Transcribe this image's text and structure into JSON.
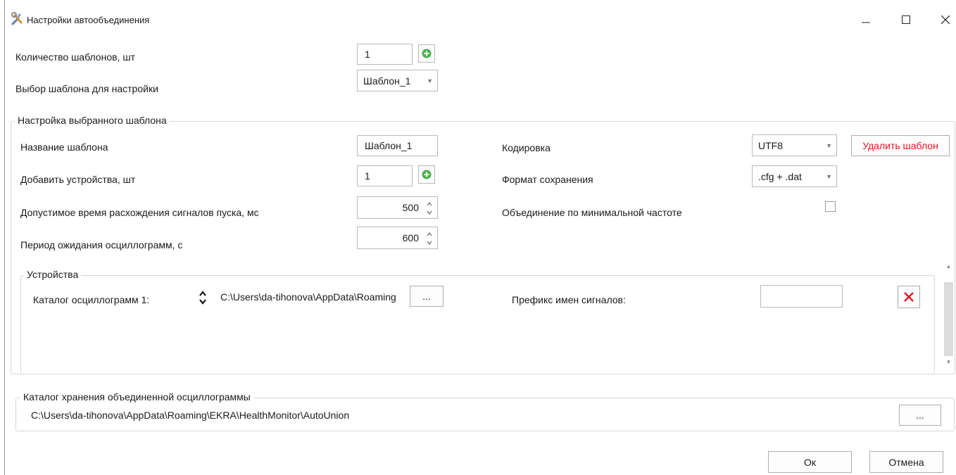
{
  "window": {
    "title": "Настройки автообъединения"
  },
  "templates": {
    "count_label": "Количество шаблонов, шт",
    "count_value": "1",
    "select_label": "Выбор шаблона для настройки",
    "select_value": "Шаблон_1"
  },
  "selected_template": {
    "group_title": "Настройка выбранного шаблона",
    "name_label": "Название шаблона",
    "name_value": "Шаблон_1",
    "devices_label": "Добавить устройства, шт",
    "devices_value": "1",
    "start_diff_label": "Допустимое время расхождения сигналов пуска, мс",
    "start_diff_value": "500",
    "wait_label": "Период ожидания осциллограмм, с",
    "wait_value": "600",
    "encoding_label": "Кодировка",
    "encoding_value": "UTF8",
    "delete_label": "Удалить шаблон",
    "format_label": "Формат сохранения",
    "format_value": ".cfg + .dat",
    "minfreq_label": "Объединение по минимальной частоте",
    "minfreq_checked": false
  },
  "devices": {
    "group_title": "Устройства",
    "rows": [
      {
        "catalog_label": "Каталог осциллограмм 1:",
        "path": "C:\\Users\\da-tihonova\\AppData\\Roaming",
        "browse_label": "...",
        "prefix_label": "Префикс имен сигналов:",
        "prefix_value": ""
      }
    ]
  },
  "output": {
    "group_title": "Каталог хранения объединенной осциллограммы",
    "path": "C:\\Users\\da-tihonova\\AppData\\Roaming\\EKRA\\HealthMonitor\\AutoUnion",
    "browse_label": "..."
  },
  "buttons": {
    "ok": "Ок",
    "cancel": "Отмена"
  },
  "colors": {
    "delete_text": "#e81123",
    "add_icon": "#4caf50",
    "remove_icon": "#e81123"
  }
}
